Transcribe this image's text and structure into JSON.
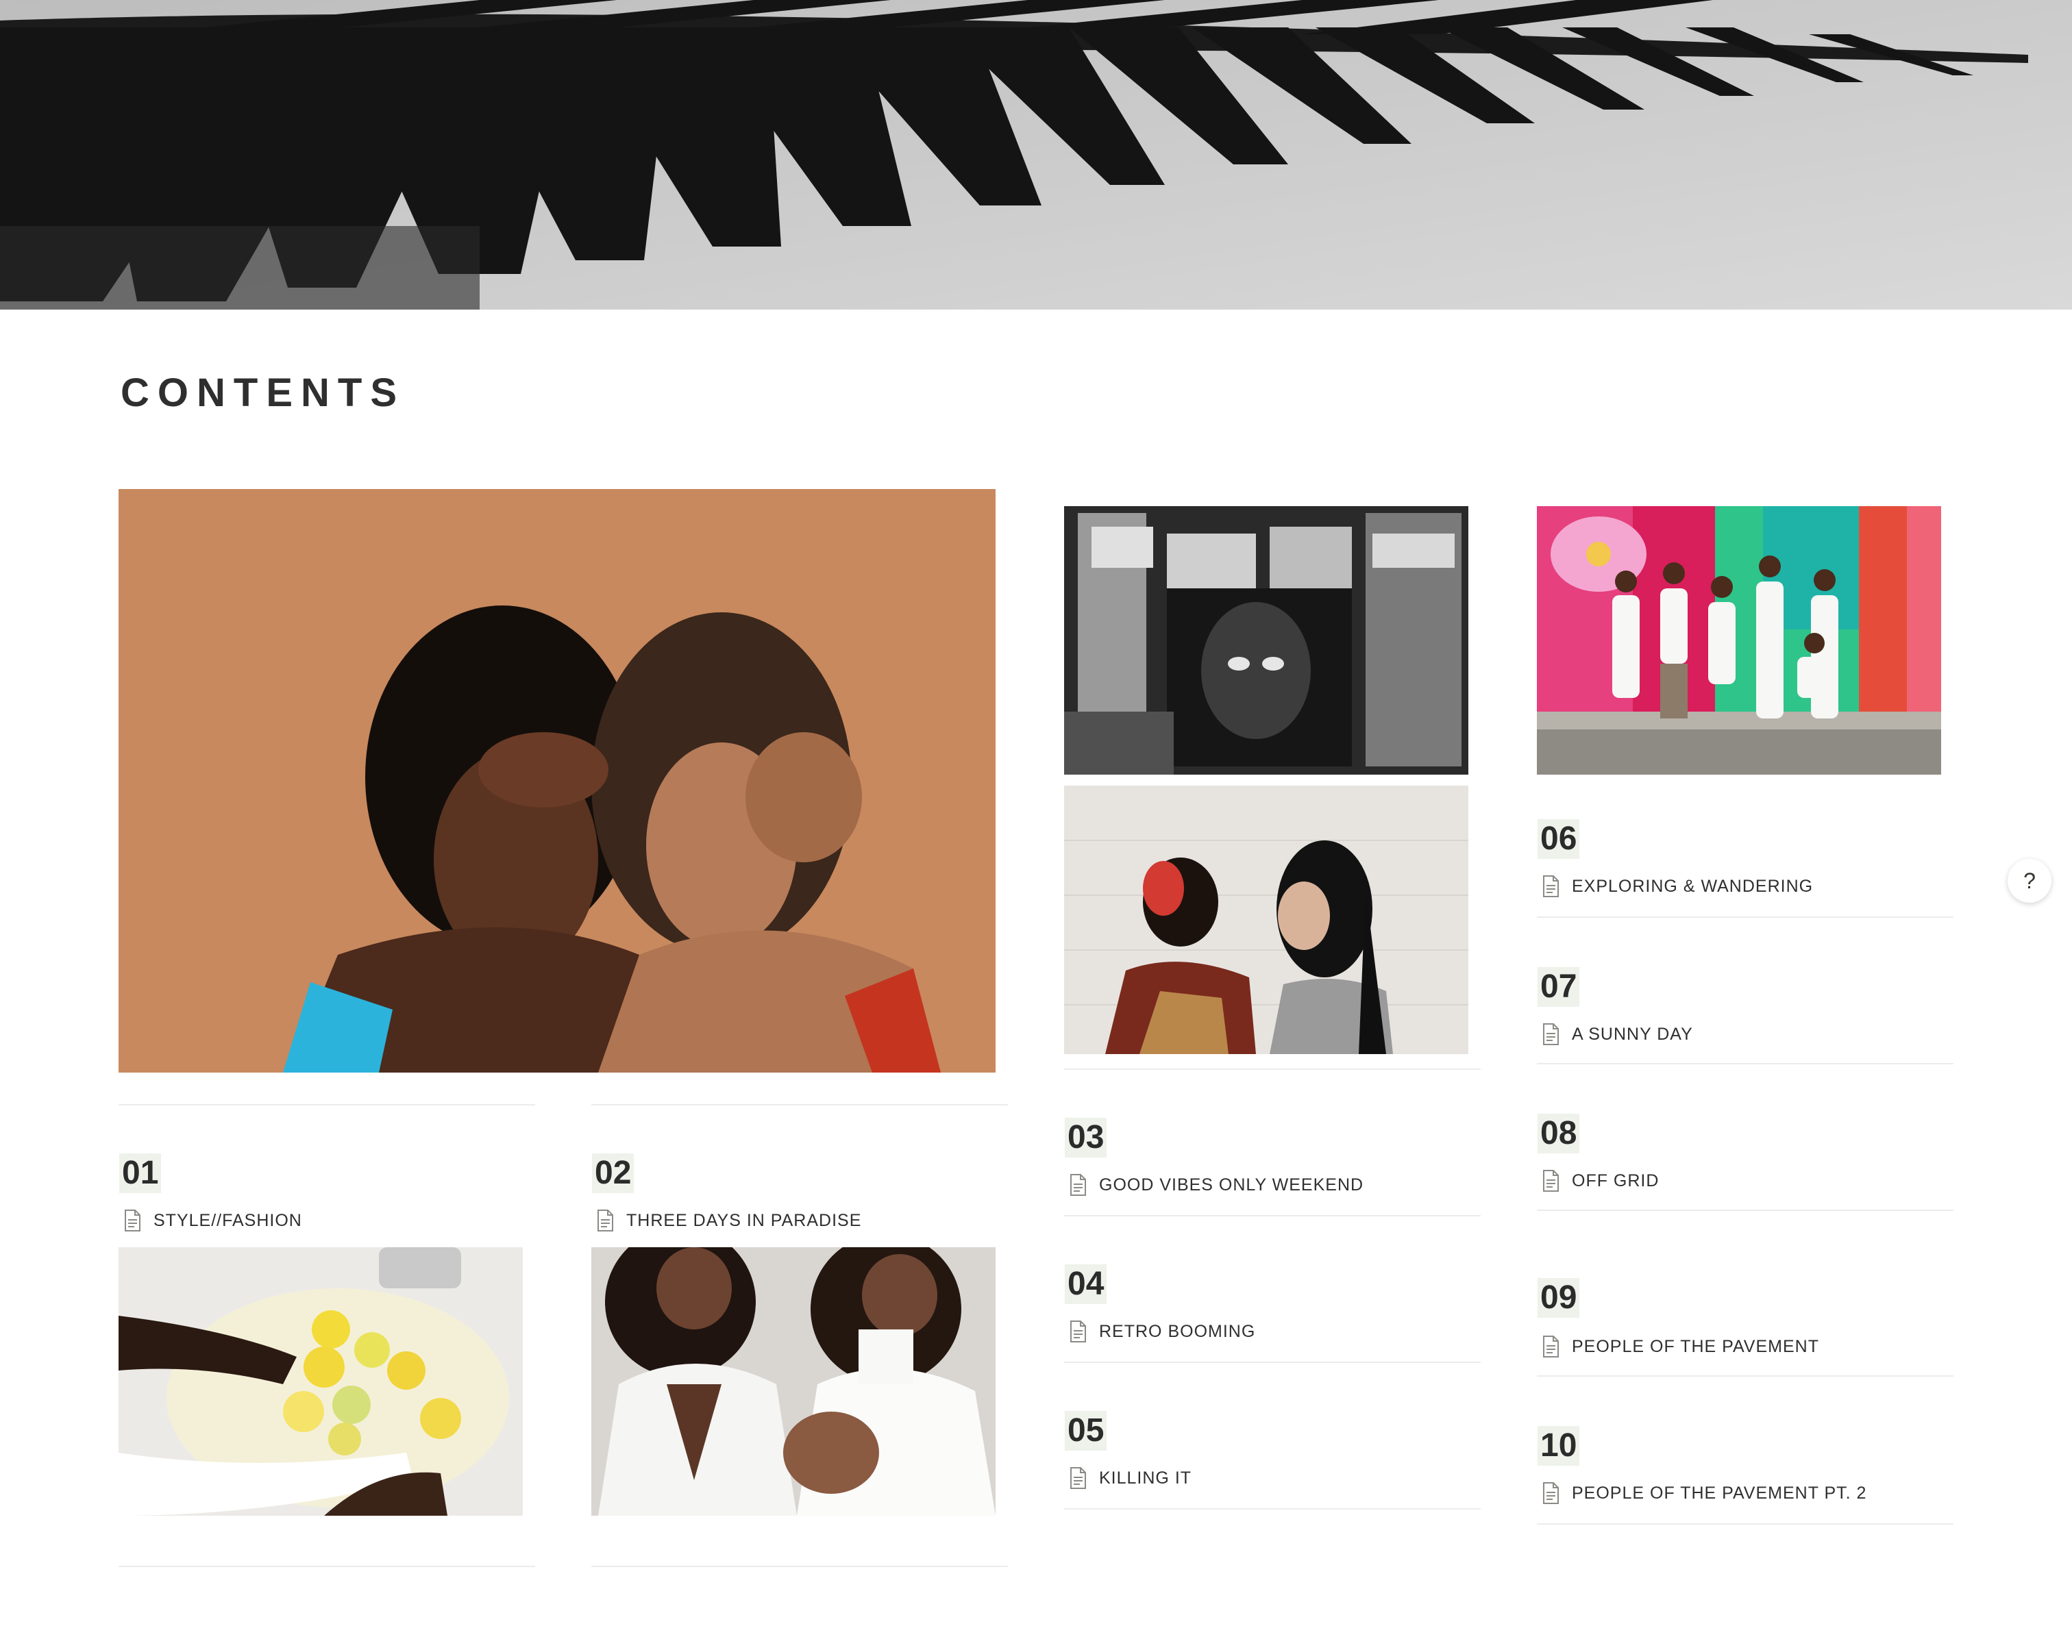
{
  "page": {
    "title": "CONTENTS",
    "help_label": "?"
  },
  "cover": {
    "icon": "palm-leaf-image"
  },
  "colors": {
    "text": "#37352f",
    "number_highlight": "#eef2ea",
    "divider": "#ececea"
  },
  "entries": [
    {
      "number": "01",
      "title": "STYLE//FASHION",
      "icon": "page-icon"
    },
    {
      "number": "02",
      "title": "THREE DAYS IN PARADISE",
      "icon": "page-icon"
    },
    {
      "number": "03",
      "title": "GOOD VIBES ONLY WEEKEND",
      "icon": "page-icon"
    },
    {
      "number": "04",
      "title": "RETRO BOOMING",
      "icon": "page-icon"
    },
    {
      "number": "05",
      "title": "KILLING IT",
      "icon": "page-icon"
    },
    {
      "number": "06",
      "title": "EXPLORING & WANDERING",
      "icon": "page-icon"
    },
    {
      "number": "07",
      "title": "A SUNNY DAY",
      "icon": "page-icon"
    },
    {
      "number": "08",
      "title": "OFF GRID",
      "icon": "page-icon"
    },
    {
      "number": "09",
      "title": "PEOPLE OF THE PAVEMENT",
      "icon": "page-icon"
    },
    {
      "number": "10",
      "title": "PEOPLE OF THE PAVEMENT PT. 2",
      "icon": "page-icon"
    }
  ]
}
